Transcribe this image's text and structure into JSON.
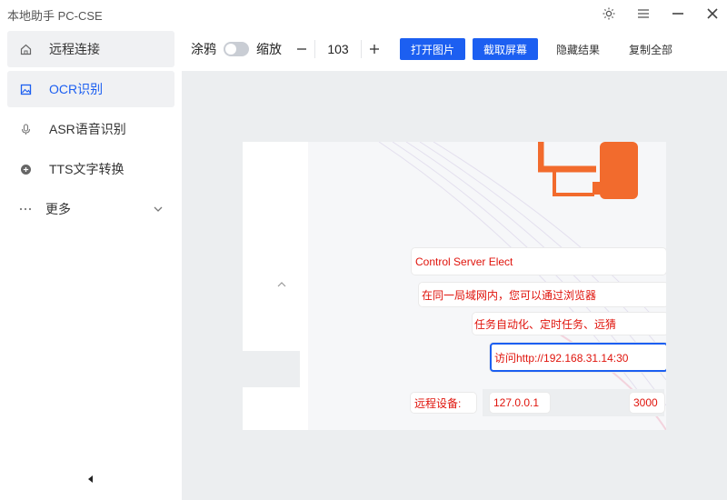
{
  "app": {
    "title": "本地助手 PC-CSE"
  },
  "window_controls": {
    "theme_icon": "sun-icon",
    "menu_icon": "hamburger-icon",
    "minimize_icon": "minimize-icon",
    "close_icon": "close-icon"
  },
  "sidebar": {
    "items": [
      {
        "label": "远程连接",
        "icon": "home-icon"
      },
      {
        "label": "OCR识别",
        "icon": "image-icon"
      },
      {
        "label": "ASR语音识别",
        "icon": "microphone-icon"
      },
      {
        "label": "TTS文字转换",
        "icon": "text-convert-icon"
      }
    ],
    "more": {
      "label": "更多",
      "icon": "ellipsis-icon",
      "chevron": "chevron-down-icon"
    },
    "collapse_icon": "caret-left-icon"
  },
  "toolbar": {
    "doodle_label": "涂鸦",
    "zoom_label": "缩放",
    "zoom_value": "103",
    "open_image": "打开图片",
    "capture_screen": "截取屏幕",
    "hide_results": "隐藏结果",
    "copy_all": "复制全部"
  },
  "ocr_results": [
    {
      "text": "Control Server Elect"
    },
    {
      "text": "在同一局域网内，您可以通过浏览器"
    },
    {
      "text": "任务自动化、定时任务、远猜"
    },
    {
      "text": "访问http://192.168.31.14:30"
    },
    {
      "text": "远程设备:"
    },
    {
      "text": "127.0.0.1"
    },
    {
      "text": "3000"
    }
  ],
  "colors": {
    "accent": "#1c5ff1",
    "ocr_text": "#e0140c",
    "logo": "#f26b2d"
  }
}
